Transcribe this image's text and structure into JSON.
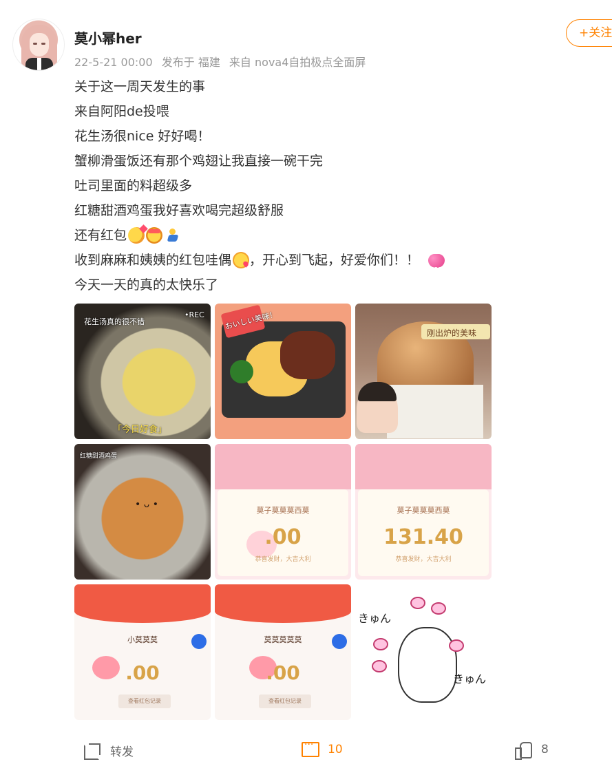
{
  "post": {
    "username": "莫小幂her",
    "meta": {
      "time": "22-5-21 00:00",
      "location": "发布于 福建",
      "source": "来自 nova4自拍极点全面屏"
    },
    "follow_label": "+关注",
    "lines": [
      "关于这一周天发生的事",
      "来自阿阳de投喂",
      "花生汤很nice 好好喝！",
      "蟹柳滑蛋饭还有那个鸡翅让我直接一碗干完",
      "吐司里面的料超级多",
      "红糖甜酒鸡蛋我好喜欢喝完超级舒服",
      "还有红包",
      "收到麻麻和姨姨的红包哇偶",
      "，开心到飞起，好爱你们！！",
      "今天一天的真的太快乐了"
    ],
    "emoji_520": "520"
  },
  "images": {
    "soup_caption": "花生汤真的很不错",
    "soup_rec": "•REC",
    "soup_stamp": "「今日好食」",
    "rice_sticker": "おいしい美味！",
    "bread_caption": "刚出炉的美味",
    "tea_label": "红糖甜酒鸡蛋",
    "tea_face": "• ᴗ •",
    "redpack1": {
      "brand": "莫子莫莫莫西莫",
      "amount": ".00",
      "note": "恭喜发财，大吉大利"
    },
    "redpack2": {
      "brand": "莫子莫莫莫西莫",
      "amount": "131.40",
      "note": "恭喜发财，大吉大利"
    },
    "screen1": {
      "brand": "小莫莫莫",
      "amount": ".00",
      "btn": "查看红包记录"
    },
    "screen2": {
      "brand": "莫莫莫莫莫",
      "amount": ".00",
      "btn": "查看红包记录"
    },
    "sticker_text1": "きゅん",
    "sticker_text2": "きゅん"
  },
  "actions": {
    "share_label": "转发",
    "comment_count": "10",
    "like_count": "8"
  }
}
